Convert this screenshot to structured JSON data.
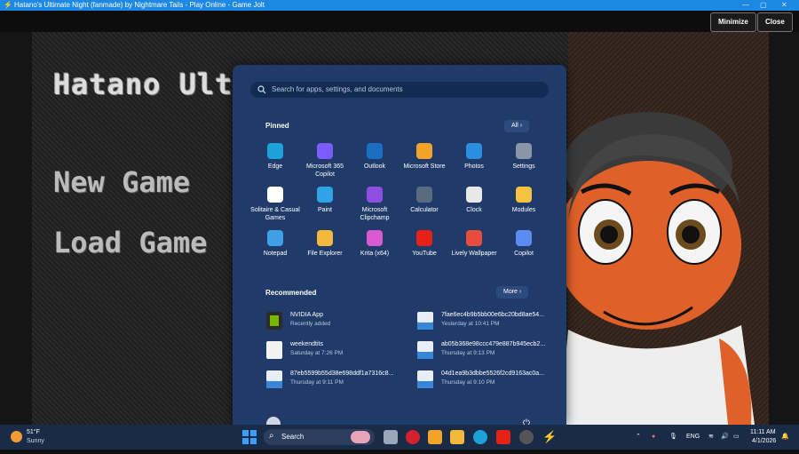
{
  "window": {
    "title": "Hatano's Ultimate Night (fanmade) by Nightmare Tails - Play Online - Game Jolt",
    "minimize_label": "Minimize",
    "close_label": "Close"
  },
  "game": {
    "title": "Hatano Ultimate N",
    "menu": [
      "New Game",
      "Load Game"
    ]
  },
  "start_menu": {
    "search_placeholder": "Search for apps, settings, and documents",
    "pinned_label": "Pinned",
    "all_label": "All",
    "pinned": [
      {
        "label": "Edge",
        "icon": "edge-icon",
        "color": "#1ea0d8"
      },
      {
        "label": "Microsoft 365 Copilot",
        "icon": "m365-copilot-icon",
        "color": "#7b5cff"
      },
      {
        "label": "Outlook",
        "icon": "outlook-icon",
        "color": "#1b6ec2"
      },
      {
        "label": "Microsoft Store",
        "icon": "store-icon",
        "color": "#f2a42a"
      },
      {
        "label": "Photos",
        "icon": "photos-icon",
        "color": "#2a8fe0"
      },
      {
        "label": "Settings",
        "icon": "settings-icon",
        "color": "#8a96a8"
      },
      {
        "label": "Solitaire & Casual Games",
        "icon": "solitaire-icon",
        "color": "#ffffff"
      },
      {
        "label": "Paint",
        "icon": "paint-icon",
        "color": "#2fa3e6"
      },
      {
        "label": "Microsoft Clipchamp",
        "icon": "clipchamp-icon",
        "color": "#8d4fe0"
      },
      {
        "label": "Calculator",
        "icon": "calculator-icon",
        "color": "#5a6b80"
      },
      {
        "label": "Clock",
        "icon": "clock-icon",
        "color": "#e8e8e8"
      },
      {
        "label": "Modules",
        "icon": "folder-icon",
        "color": "#f5c242"
      },
      {
        "label": "Notepad",
        "icon": "notepad-icon",
        "color": "#3fa0e8"
      },
      {
        "label": "File Explorer",
        "icon": "file-explorer-icon",
        "color": "#f4b83a"
      },
      {
        "label": "Krita (x64)",
        "icon": "krita-icon",
        "color": "#d85ad0"
      },
      {
        "label": "YouTube",
        "icon": "youtube-icon",
        "color": "#e62117"
      },
      {
        "label": "Lively Wallpaper",
        "icon": "lively-wallpaper-icon",
        "color": "#e74c3c"
      },
      {
        "label": "Copilot",
        "icon": "copilot-icon",
        "color": "#5b8cf0"
      }
    ],
    "recommended_label": "Recommended",
    "more_label": "More",
    "recommended": [
      {
        "name": "NVIDIA App",
        "time": "Recently added",
        "icon": "nvidia-icon"
      },
      {
        "name": "7fae6ec4b9b5bb00e6bc20bd8ae54...",
        "time": "Yesterday at 10:41 PM",
        "icon": "image-file-icon"
      },
      {
        "name": "weekendtits",
        "time": "Saturday at 7:26 PM",
        "icon": "document-icon"
      },
      {
        "name": "ab05b368e98ccc479e887b945ecb2...",
        "time": "Thursday at 9:13 PM",
        "icon": "image-file-icon"
      },
      {
        "name": "87eb5599b55d38e698ddf1a7316c8...",
        "time": "Thursday at 9:11 PM",
        "icon": "image-file-icon"
      },
      {
        "name": "04d1ea9b3dbbe5526f2cd9163ac0a...",
        "time": "Thursday at 9:10 PM",
        "icon": "image-file-icon"
      }
    ]
  },
  "taskbar": {
    "weather_temp": "51°F",
    "weather_desc": "Sunny",
    "search_label": "Search",
    "language": "ENG",
    "time": "11:11 AM",
    "date": "4/1/2026"
  }
}
